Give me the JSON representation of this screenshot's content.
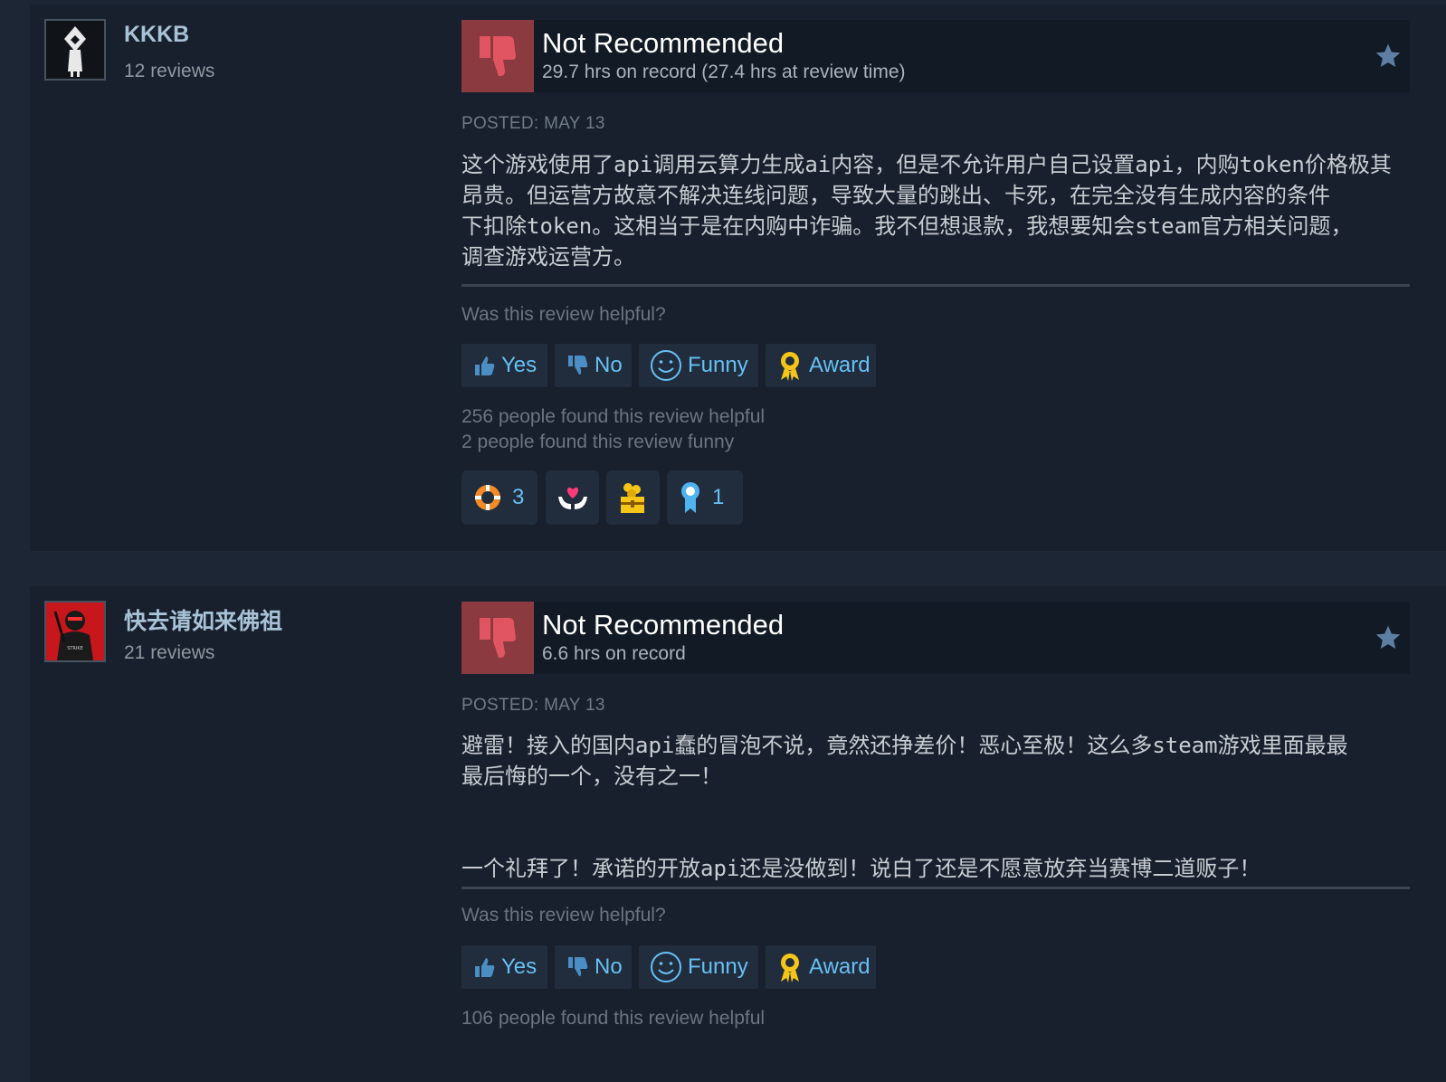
{
  "reviews": [
    {
      "author": "KKKB",
      "review_count": "12 reviews",
      "verdict": "Not Recommended",
      "hours": "29.7 hrs on record (27.4 hrs at review time)",
      "posted": "POSTED: MAY 13",
      "text": "这个游戏使用了api调用云算力生成ai内容，但是不允许用户自己设置api，内购token价格极其\n昂贵。但运营方故意不解决连线问题，导致大量的跳出、卡死，在完全没有生成内容的条件\n下扣除token。这相当于是在内购中诈骗。我不但想退款，我想要知会steam官方相关问题，\n调查游戏运营方。",
      "helpful_question": "Was this review helpful?",
      "buttons": {
        "yes": "Yes",
        "no": "No",
        "funny": "Funny",
        "award": "Award"
      },
      "helpful_count": "256 people found this review helpful",
      "funny_count": "2 people found this review funny",
      "awards": [
        {
          "icon": "lifebuoy-icon",
          "count": "3"
        },
        {
          "icon": "heart-hands-icon",
          "count": ""
        },
        {
          "icon": "treasure-chest-icon",
          "count": ""
        },
        {
          "icon": "ribbon-icon",
          "count": "1"
        }
      ]
    },
    {
      "author": "快去请如来佛祖",
      "review_count": "21 reviews",
      "verdict": "Not Recommended",
      "hours": "6.6 hrs on record",
      "posted": "POSTED: MAY 13",
      "text": "避雷！接入的国内api蠢的冒泡不说，竟然还挣差价！恶心至极！这么多steam游戏里面最最\n最后悔的一个，没有之一！\n\n\n一个礼拜了！承诺的开放api还是没做到！说白了还是不愿意放弃当赛博二道贩子！",
      "helpful_question": "Was this review helpful?",
      "buttons": {
        "yes": "Yes",
        "no": "No",
        "funny": "Funny",
        "award": "Award"
      },
      "helpful_count": "106 people found this review helpful"
    }
  ],
  "colors": {
    "page_bg": "#1c2635",
    "card_bg": "#18202d",
    "thumb_down_bg": "#8b3b3f",
    "link_blue": "#66c0f4",
    "award_gold": "#f5c518"
  }
}
